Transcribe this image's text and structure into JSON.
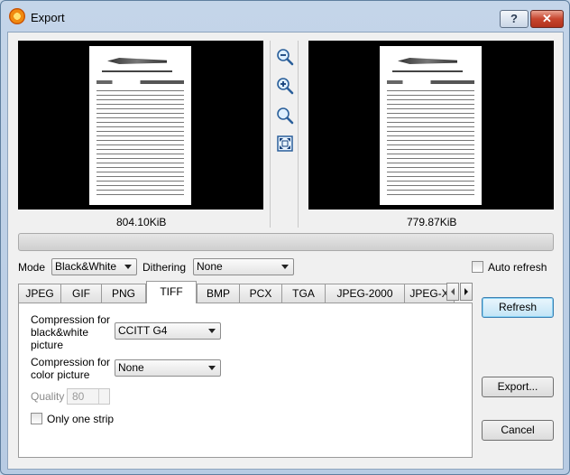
{
  "window": {
    "title": "Export",
    "help_label": "?",
    "close_label": "✕"
  },
  "preview": {
    "left_size": "804.10KiB",
    "right_size": "779.87KiB"
  },
  "zoom": {
    "zoom_out_icon": "zoom-out-icon",
    "zoom_in_icon": "zoom-in-icon",
    "zoom_actual_icon": "zoom-actual-icon",
    "fit_icon": "fit-to-window-icon"
  },
  "mode": {
    "label": "Mode",
    "value": "Black&White"
  },
  "dithering": {
    "label": "Dithering",
    "value": "None"
  },
  "auto_refresh": {
    "label": "Auto refresh",
    "checked": false
  },
  "tabs": [
    {
      "label": "JPEG"
    },
    {
      "label": "GIF"
    },
    {
      "label": "PNG"
    },
    {
      "label": "TIFF"
    },
    {
      "label": "BMP"
    },
    {
      "label": "PCX"
    },
    {
      "label": "TGA"
    },
    {
      "label": "JPEG-2000"
    },
    {
      "label": "JPEG-X"
    }
  ],
  "active_tab": "TIFF",
  "tiff": {
    "bw_label_line1": "Compression for",
    "bw_label_line2": "black&white",
    "bw_label_line3": "picture",
    "bw_value": "CCITT G4",
    "color_label_line1": "Compression for",
    "color_label_line2": "color picture",
    "color_value": "None",
    "quality_label": "Quality",
    "quality_value": "80",
    "strip_label": "Only one strip"
  },
  "buttons": {
    "refresh": "Refresh",
    "export": "Export...",
    "cancel": "Cancel"
  },
  "colors": {
    "accent": "#3c7fb1",
    "title_close": "#c7452e"
  }
}
